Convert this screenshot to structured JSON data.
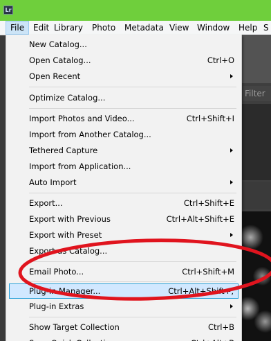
{
  "app": {
    "icon_text": "Lr",
    "titlebar_color": "#6fcf3c"
  },
  "menubar": {
    "items": [
      "File",
      "Edit",
      "Library",
      "Photo",
      "Metadata",
      "View",
      "Window",
      "Help",
      "S"
    ]
  },
  "background": {
    "filter_text": "Filter"
  },
  "file_menu": {
    "items": [
      {
        "label": "New Catalog...",
        "shortcut": ""
      },
      {
        "label": "Open Catalog...",
        "shortcut": "Ctrl+O"
      },
      {
        "label": "Open Recent",
        "shortcut": ""
      },
      {
        "label": "Optimize Catalog...",
        "shortcut": ""
      },
      {
        "label": "Import Photos and Video...",
        "shortcut": "Ctrl+Shift+I"
      },
      {
        "label": "Import from Another Catalog...",
        "shortcut": ""
      },
      {
        "label": "Tethered Capture",
        "shortcut": ""
      },
      {
        "label": "Import from Application...",
        "shortcut": ""
      },
      {
        "label": "Auto Import",
        "shortcut": ""
      },
      {
        "label": "Export...",
        "shortcut": "Ctrl+Shift+E"
      },
      {
        "label": "Export with Previous",
        "shortcut": "Ctrl+Alt+Shift+E"
      },
      {
        "label": "Export with Preset",
        "shortcut": ""
      },
      {
        "label": "Export as Catalog...",
        "shortcut": ""
      },
      {
        "label": "Email Photo...",
        "shortcut": "Ctrl+Shift+M"
      },
      {
        "label": "Plug-in Manager...",
        "shortcut": "Ctrl+Alt+Shift+,"
      },
      {
        "label": "Plug-in Extras",
        "shortcut": ""
      },
      {
        "label": "Show Target Collection",
        "shortcut": "Ctrl+B"
      },
      {
        "label": "Save Quick Collection...",
        "shortcut": "Ctrl+Alt+B"
      }
    ]
  },
  "annotation": {
    "color": "#e0141e"
  }
}
